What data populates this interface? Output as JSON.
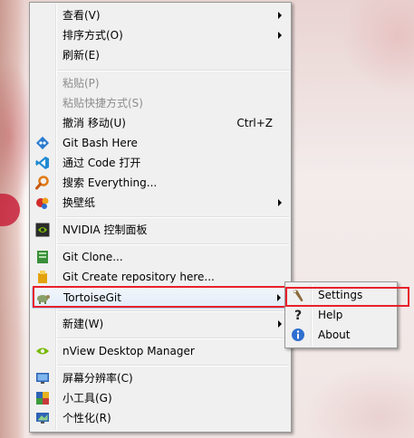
{
  "context_menu": {
    "items": [
      {
        "label": "查看(V)"
      },
      {
        "label": "排序方式(O)"
      },
      {
        "label": "刷新(E)"
      },
      {
        "label": "粘贴(P)"
      },
      {
        "label": "粘贴快捷方式(S)"
      },
      {
        "label": "撤消 移动(U)",
        "shortcut": "Ctrl+Z"
      },
      {
        "label": "Git Bash Here"
      },
      {
        "label": "通过 Code 打开"
      },
      {
        "label": "搜索 Everything..."
      },
      {
        "label": "换壁纸"
      },
      {
        "label": "NVIDIA 控制面板"
      },
      {
        "label": "Git Clone..."
      },
      {
        "label": "Git Create repository here..."
      },
      {
        "label": "TortoiseGit"
      },
      {
        "label": "新建(W)"
      },
      {
        "label": "nView Desktop Manager"
      },
      {
        "label": "屏幕分辨率(C)"
      },
      {
        "label": "小工具(G)"
      },
      {
        "label": "个性化(R)"
      }
    ]
  },
  "submenu": {
    "items": [
      {
        "label": "Settings"
      },
      {
        "label": "Help"
      },
      {
        "label": "About"
      }
    ]
  },
  "colors": {
    "menu_bg": "#f0f0f0",
    "highlight_box": "#e8202a",
    "hover_border": "#aecff7"
  }
}
